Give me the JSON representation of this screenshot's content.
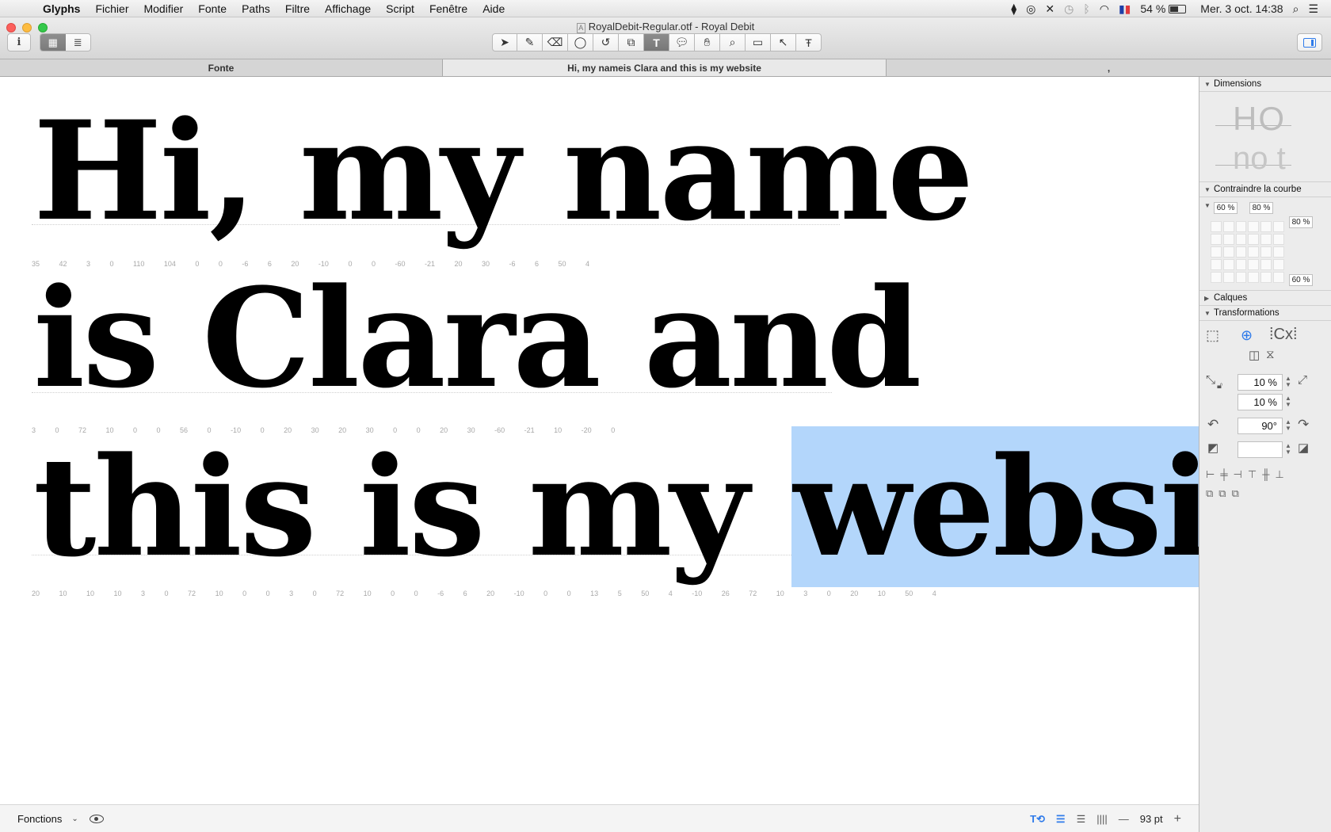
{
  "menubar": {
    "app_name": "Glyphs",
    "items": [
      "Fichier",
      "Modifier",
      "Fonte",
      "Paths",
      "Filtre",
      "Affichage",
      "Script",
      "Fenêtre",
      "Aide"
    ],
    "battery": "54 %",
    "datetime": "Mer. 3 oct.  14:38"
  },
  "window": {
    "title": "RoyalDebit-Regular.otf - Royal Debit",
    "tabs": [
      "Fonte",
      "Hi, my nameis Clara and this is my website",
      ","
    ]
  },
  "canvas": {
    "line1": "Hi, my name",
    "line2": "is Clara and",
    "line3_plain": "this is my ",
    "line3_selected": "website",
    "selection_color": "#b3d6fb",
    "metrics1": "35   42 3   0 110 104 0   0 -6   6 20   -10 0   0 -60   -21 20   30 -6   6 50   4",
    "metrics2": "3   0 72   10 0   0 56   0 -10 0 20   30 20   30 0   0 20   30 -60   -21 10   -20 0",
    "metrics3": "20   10 10   10 3   0 72   10 0   0 3   0 72   10 0   0 -6   6 20   -10 0   0 13   5 50   4 -10   26 72   10 3   0 20   10 50   4"
  },
  "bottombar": {
    "features_label": "Fonctions",
    "zoom": "93 pt"
  },
  "inspector": {
    "dimensions_label": "Dimensions",
    "dim_preview_top": "HO",
    "dim_preview_bottom": "no  t",
    "curve_label": "Contraindre la courbe",
    "curve_values": [
      "60 %",
      "80 %",
      "80 %",
      "60 %"
    ],
    "layers_label": "Calques",
    "transform_label": "Transformations",
    "scale_x": "10 %",
    "scale_y": "10 %",
    "rotate": "90°",
    "slant": ""
  }
}
